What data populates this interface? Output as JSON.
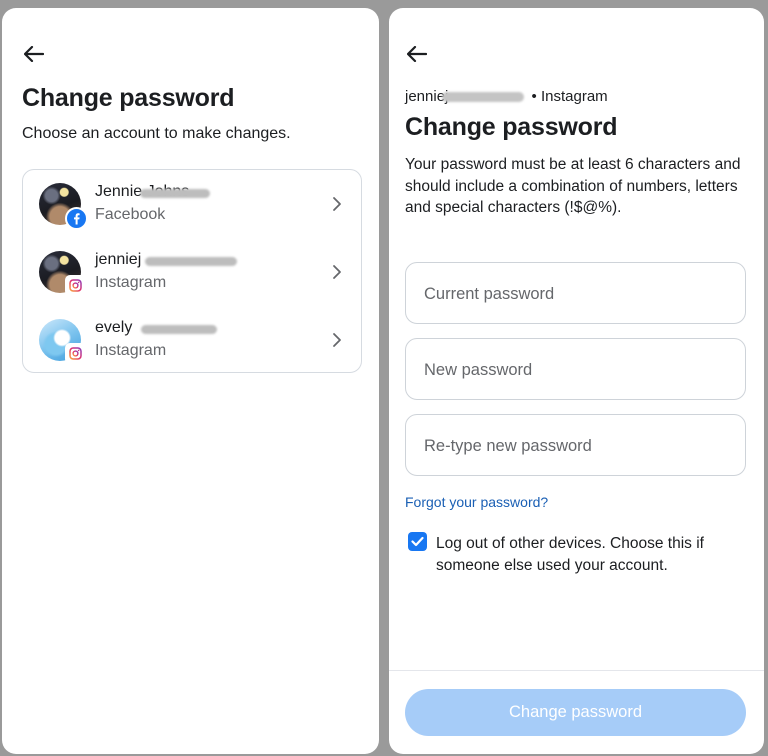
{
  "left": {
    "title": "Change password",
    "subtitle": "Choose an account to make changes.",
    "accounts": [
      {
        "name": "Jennie Johns",
        "platform": "Facebook",
        "badge_icon": "facebook-icon"
      },
      {
        "name": "jenniej",
        "platform": "Instagram",
        "badge_icon": "instagram-icon"
      },
      {
        "name": "evely",
        "platform": "Instagram",
        "badge_icon": "instagram-icon"
      }
    ]
  },
  "right": {
    "account_name": "jenniej",
    "account_suffix": "• Instagram",
    "title": "Change password",
    "description": "Your password must be at least 6 characters and should include a combination of numbers, letters and special characters (!$@%).",
    "fields": {
      "current_placeholder": "Current password",
      "new_placeholder": "New password",
      "retype_placeholder": "Re-type new password"
    },
    "forgot_link": "Forgot your password?",
    "logout_label": "Log out of other devices. Choose this if someone else used your account.",
    "logout_checked": true,
    "submit_label": "Change password"
  },
  "colors": {
    "accent": "#1877f2",
    "submit_disabled": "#a6ccf8",
    "link": "#1a5fb4",
    "secondary_text": "#65676b"
  }
}
